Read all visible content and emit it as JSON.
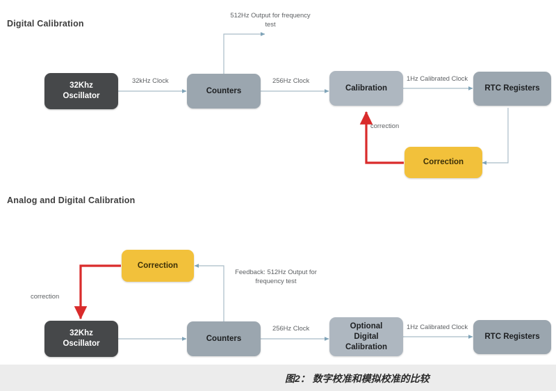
{
  "figure": {
    "caption": "图2： 数字校准和模拟校准的比较"
  },
  "colors": {
    "oscillator_fill": "#46484a",
    "block_fill": "#9ba6af",
    "calibration_fill": "#aeb7c0",
    "correction_fill": "#f2c13b",
    "wire": "#9fb3c0",
    "correction_wire": "#d92b2b",
    "footer_band": "#ececec",
    "title_text": "#3d3d3d",
    "label_text": "#5d6063"
  },
  "diagrams": [
    {
      "id": "digital-calibration",
      "title": "Digital Calibration",
      "nodes": [
        {
          "id": "oscillator",
          "label_lines": [
            "32Khz",
            "Oscillator"
          ],
          "style": "dark"
        },
        {
          "id": "counters",
          "label_lines": [
            "Counters"
          ],
          "style": "gray"
        },
        {
          "id": "calibration",
          "label_lines": [
            "Calibration"
          ],
          "style": "gray2"
        },
        {
          "id": "rtc-registers",
          "label_lines": [
            "RTC Registers"
          ],
          "style": "gray"
        },
        {
          "id": "correction",
          "label_lines": [
            "Correction"
          ],
          "style": "yellow"
        }
      ],
      "edges": [
        {
          "id": "osc-to-counters",
          "label_lines": [
            "32kHz Clock"
          ],
          "kind": "signal"
        },
        {
          "id": "counters-to-calibration",
          "label_lines": [
            "256Hz Clock"
          ],
          "kind": "signal"
        },
        {
          "id": "calibration-to-rtc",
          "label_lines": [
            "1Hz Calibrated Clock"
          ],
          "kind": "signal"
        },
        {
          "id": "counters-freq-test",
          "label_lines": [
            "512Hz Output for",
            "frequency test"
          ],
          "kind": "signal"
        },
        {
          "id": "correction-to-calibration",
          "label_lines": [
            "correction"
          ],
          "kind": "correction"
        },
        {
          "id": "rtc-to-correction",
          "label_lines": [],
          "kind": "signal"
        }
      ]
    },
    {
      "id": "analog-and-digital-calibration",
      "title": "Analog and Digital Calibration",
      "nodes": [
        {
          "id": "correction2",
          "label_lines": [
            "Correction"
          ],
          "style": "yellow"
        },
        {
          "id": "oscillator2",
          "label_lines": [
            "32Khz",
            "Oscillator"
          ],
          "style": "dark"
        },
        {
          "id": "counters2",
          "label_lines": [
            "Counters"
          ],
          "style": "gray"
        },
        {
          "id": "optional-digital-calibration",
          "label_lines": [
            "Optional",
            "Digital",
            "Calibration"
          ],
          "style": "gray2"
        },
        {
          "id": "rtc-registers2",
          "label_lines": [
            "RTC Registers"
          ],
          "style": "gray"
        }
      ],
      "edges": [
        {
          "id": "correction-to-oscillator",
          "label_lines": [
            "correction"
          ],
          "kind": "correction"
        },
        {
          "id": "counters-feedback",
          "label_lines": [
            "Feedback:",
            "512Hz Output for",
            "frequency test"
          ],
          "kind": "signal"
        },
        {
          "id": "osc2-to-counters2",
          "label_lines": [],
          "kind": "signal"
        },
        {
          "id": "counters2-to-optional",
          "label_lines": [
            "256Hz Clock"
          ],
          "kind": "signal"
        },
        {
          "id": "optional-to-rtc2",
          "label_lines": [
            "1Hz Calibrated Clock"
          ],
          "kind": "signal"
        }
      ]
    }
  ]
}
